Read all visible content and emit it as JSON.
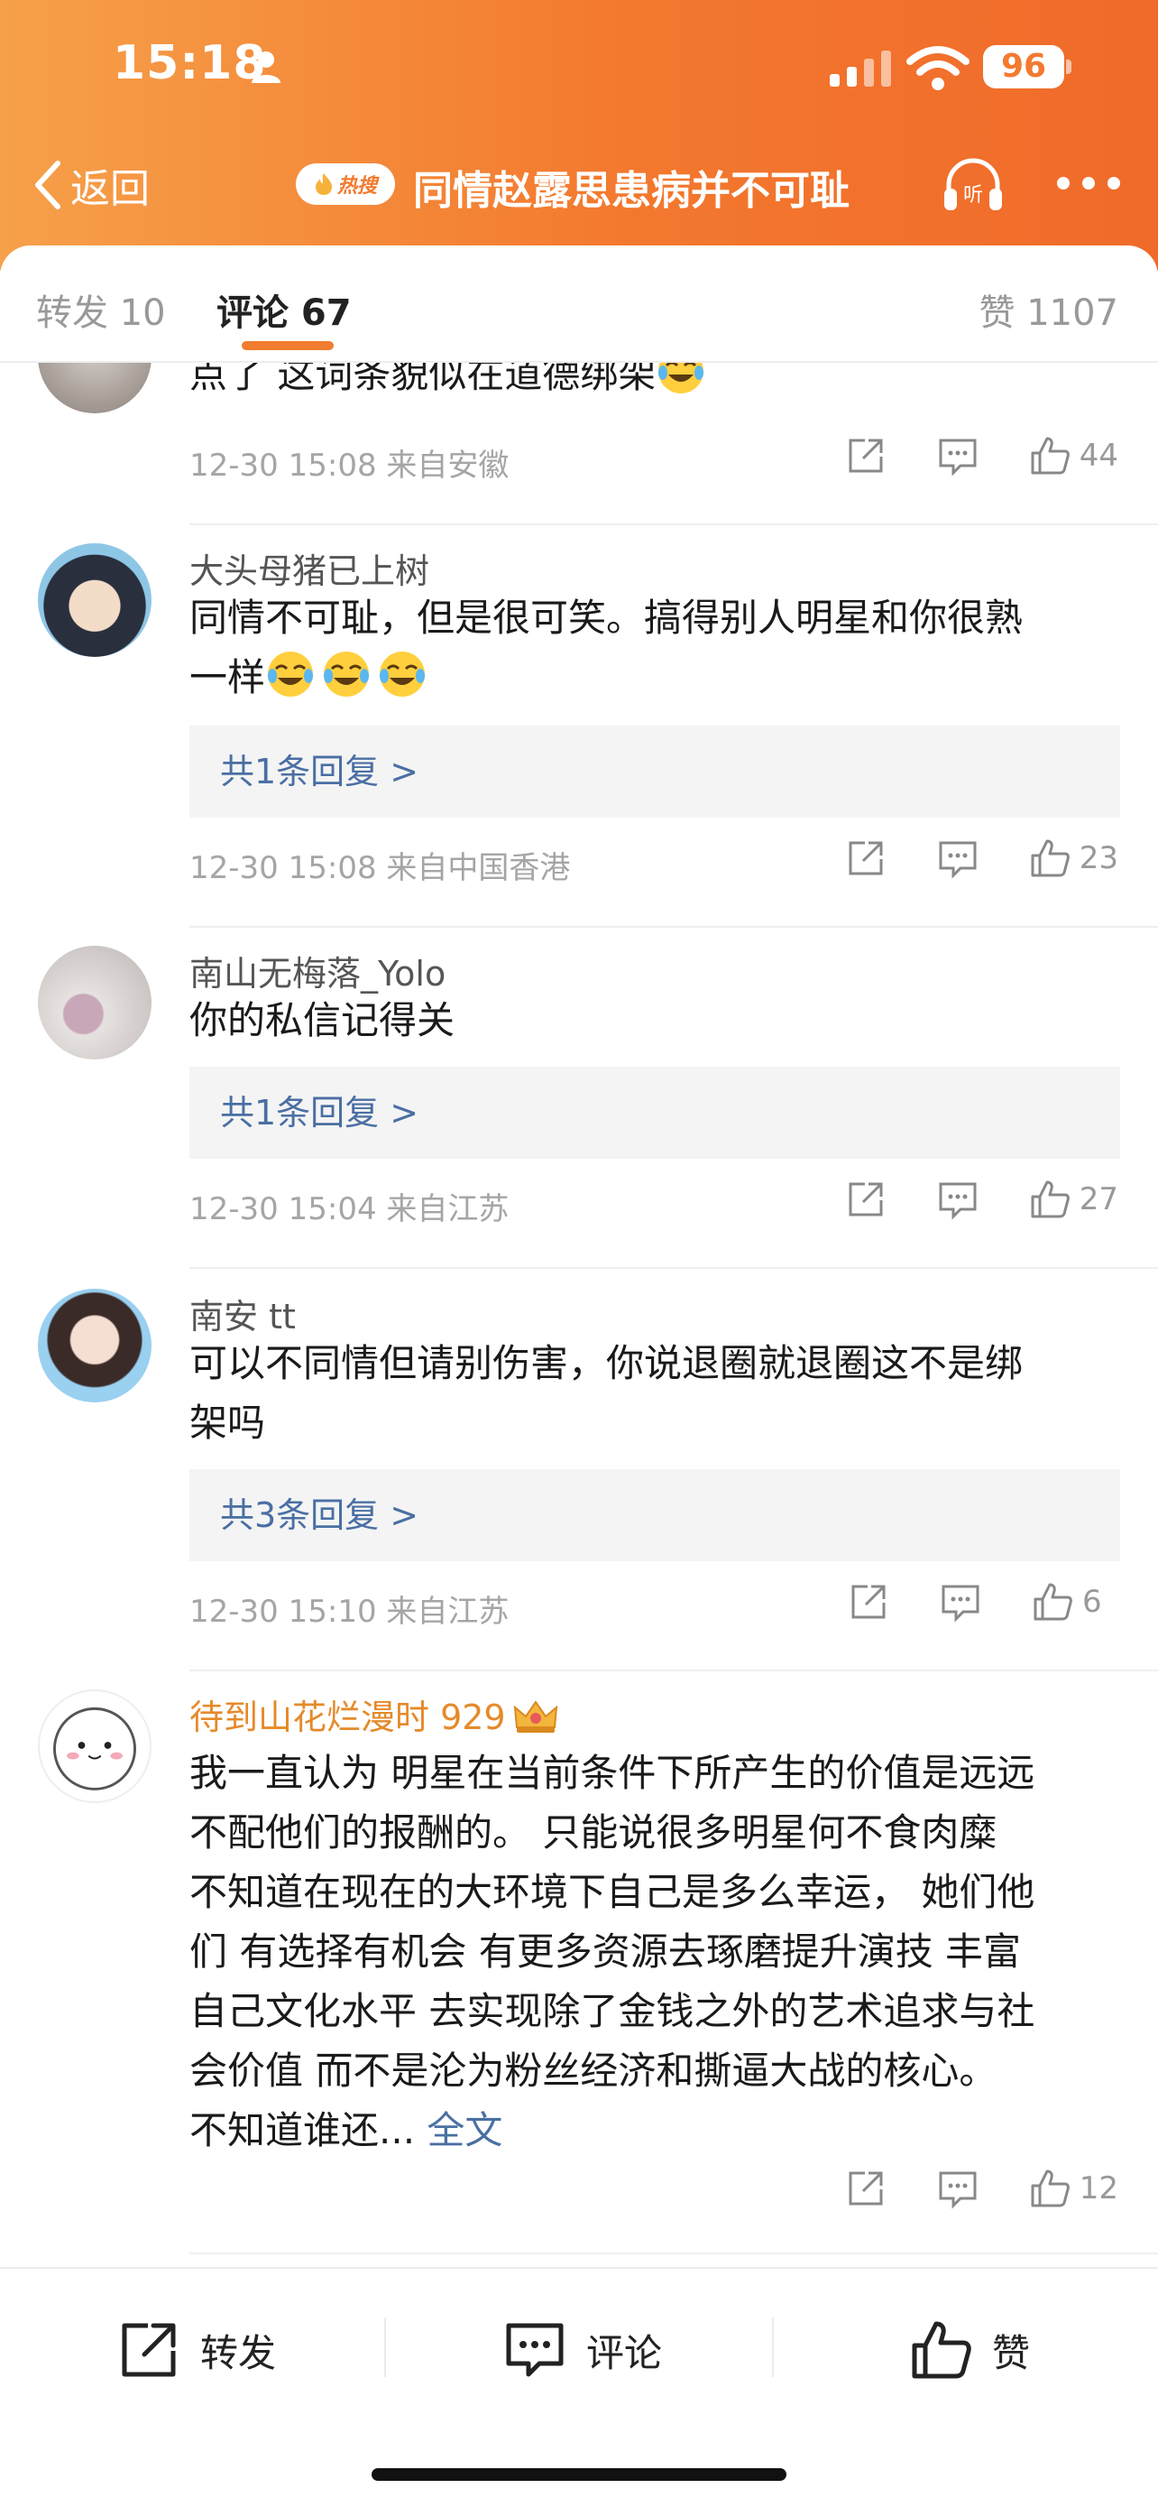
{
  "status": {
    "time": "15:18",
    "battery": "96"
  },
  "nav": {
    "back_label": "返回",
    "hot_badge": "热搜",
    "title": "同情赵露思患病并不可耻"
  },
  "tabs": {
    "repost": "转发 10",
    "comment": "评论 67",
    "likes": "赞 1107"
  },
  "comments": [
    {
      "username": "",
      "text": "点了 这词条貌似在道德绑架",
      "emojis": 1,
      "meta": "12-30 15:08 来自安徽",
      "likes": "44"
    },
    {
      "username": "大头母猪已上树",
      "text_line1": "同情不可耻，但是很可笑。搞得别人明星和你很熟",
      "text_line2": "一样",
      "emojis": 3,
      "reply": "共1条回复 >",
      "meta": "12-30 15:08 来自中国香港",
      "likes": "23"
    },
    {
      "username": "南山无梅落_Yolo",
      "text": "你的私信记得关",
      "reply": "共1条回复 >",
      "meta": "12-30 15:04 来自江苏",
      "likes": "27"
    },
    {
      "username": "南安 tt",
      "text_line1": "可以不同情但请别伤害，你说退圈就退圈这不是绑",
      "text_line2": "架吗",
      "reply": "共3条回复 >",
      "meta": "12-30 15:10 来自江苏",
      "likes": "6"
    },
    {
      "username": "待到山花烂漫时 929",
      "lines": [
        "我一直认为 明星在当前条件下所产生的价值是远远",
        "不配他们的报酬的。 只能说很多明星何不食肉糜",
        "不知道在现在的大环境下自己是多么幸运， 她们他",
        "们 有选择有机会 有更多资源去琢磨提升演技 丰富",
        "自己文化水平 去实现除了金钱之外的艺术追求与社",
        "会价值 而不是沦为粉丝经济和撕逼大战的核心。",
        "不知道谁还..."
      ],
      "full_link": "全文",
      "likes": "12"
    }
  ],
  "bottom_bar": {
    "repost": "转发",
    "comment": "评论",
    "like": "赞"
  },
  "colors": {
    "accent": "#f27c2f",
    "link": "#4a6fa3",
    "header_start": "#f6a04a",
    "header_end": "#f06a2a"
  }
}
